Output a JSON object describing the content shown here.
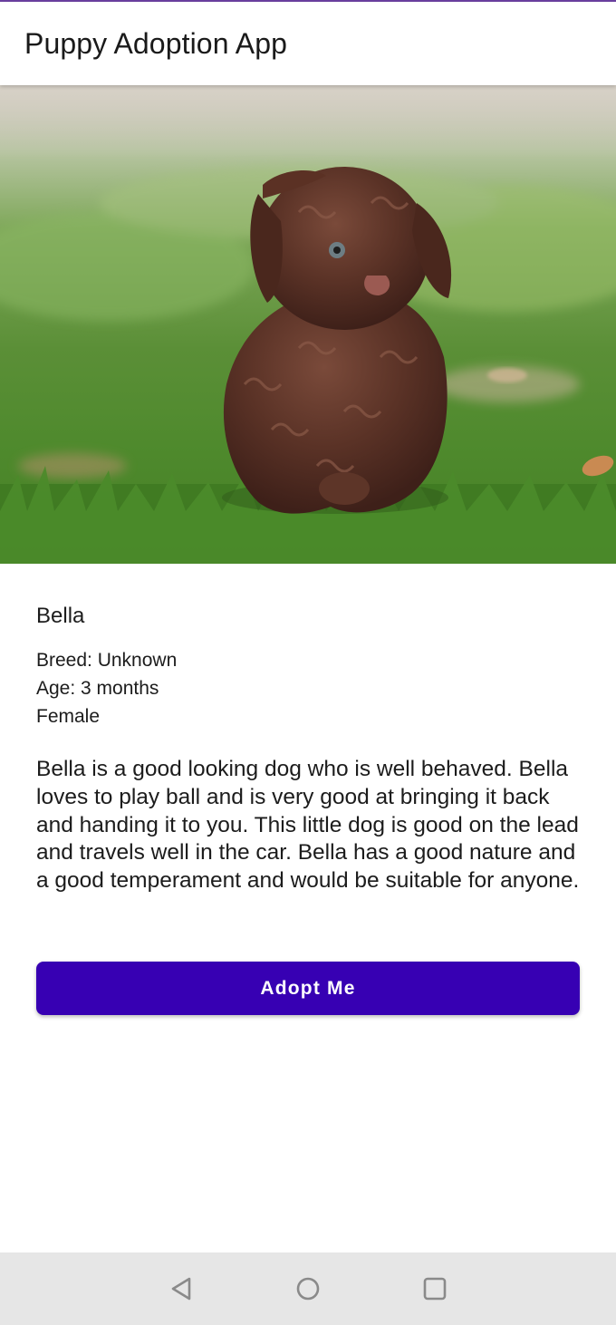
{
  "app_bar": {
    "title": "Puppy Adoption App"
  },
  "hero": {
    "image_alt": "Brown curly puppy sitting on grass"
  },
  "puppy": {
    "name": "Bella",
    "breed": "Breed: Unknown",
    "age": "Age: 3 months",
    "sex": "Female",
    "description": "Bella is a good looking dog who is well behaved. Bella loves to play ball and is very good at bringing it back and handing it to you. This little dog is good on the lead and travels well in the car. Bella has a good nature and a good temperament and would be suitable for anyone."
  },
  "actions": {
    "adopt_label": "Adopt Me"
  },
  "colors": {
    "accent": "#3700b3",
    "nav_bar": "#e6e6e6",
    "nav_icon": "#8a8a8a"
  },
  "system_nav": {
    "icons": [
      "back-icon",
      "home-icon",
      "recents-icon"
    ]
  }
}
